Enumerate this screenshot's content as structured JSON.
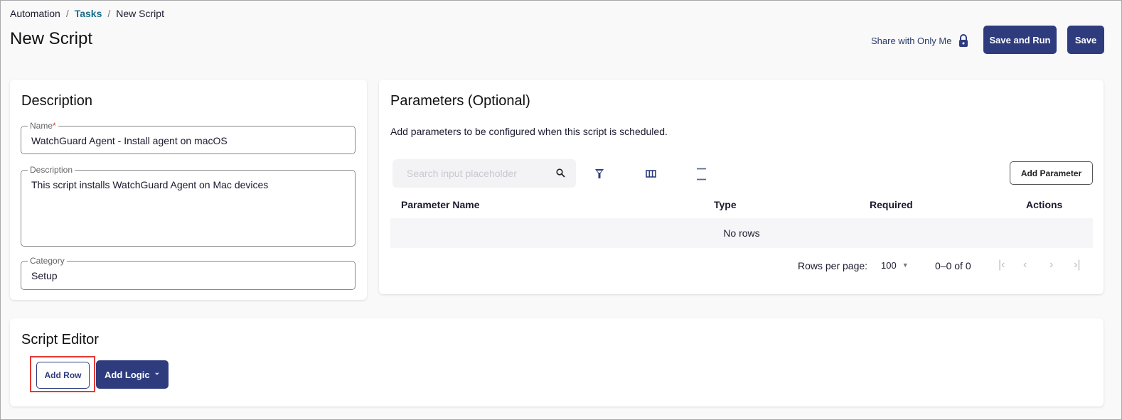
{
  "breadcrumb": {
    "items": [
      "Automation",
      "Tasks",
      "New Script"
    ]
  },
  "page_title": "New Script",
  "header": {
    "share_label": "Share with Only Me",
    "save_and_run": "Save and Run",
    "save": "Save"
  },
  "description_card": {
    "title": "Description",
    "name_label": "Name",
    "name_required": "*",
    "name_value": "WatchGuard Agent - Install agent on macOS",
    "description_label": "Description",
    "description_value": "This script installs WatchGuard Agent on Mac devices",
    "category_label": "Category",
    "category_value": "Setup"
  },
  "parameters_card": {
    "title": "Parameters (Optional)",
    "subtitle": "Add parameters to be configured when this script is scheduled.",
    "search_placeholder": "Search input placeholder",
    "add_parameter": "Add Parameter",
    "columns": [
      "Parameter Name",
      "Type",
      "Required",
      "Actions"
    ],
    "empty_text": "No rows",
    "rows_per_page_label": "Rows per page:",
    "rows_per_page_value": "100",
    "range_text": "0–0 of 0"
  },
  "script_editor": {
    "title": "Script Editor",
    "add_row": "Add Row",
    "add_logic": "Add Logic"
  },
  "colors": {
    "primary": "#2e3c7e",
    "link": "#1a6e8a",
    "highlight": "#e53935"
  }
}
